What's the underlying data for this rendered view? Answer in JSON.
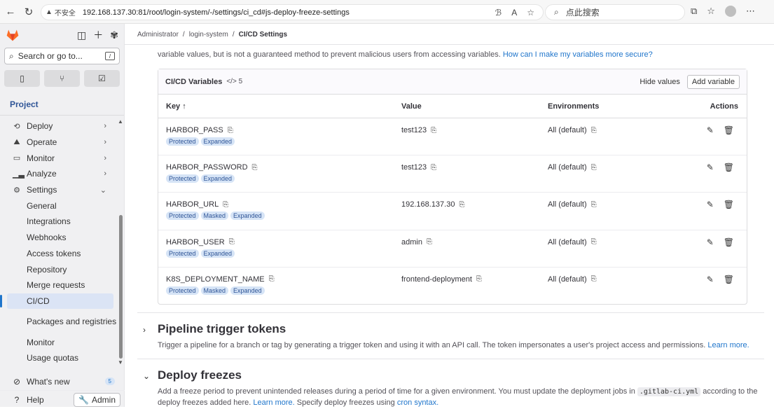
{
  "browser": {
    "security_label": "不安全",
    "url": "192.168.137.30:81/root/login-system/-/settings/ci_cd#js-deploy-freeze-settings",
    "search_placeholder": "点此搜索"
  },
  "sidebar": {
    "search_placeholder": "Search or go to...",
    "section_label": "Project",
    "items": [
      {
        "label": "Deploy",
        "icon": "deploy-icon"
      },
      {
        "label": "Operate",
        "icon": "operate-icon"
      },
      {
        "label": "Monitor",
        "icon": "monitor-icon"
      },
      {
        "label": "Analyze",
        "icon": "analyze-icon"
      },
      {
        "label": "Settings",
        "icon": "settings-icon"
      }
    ],
    "sub_items": [
      "General",
      "Integrations",
      "Webhooks",
      "Access tokens",
      "Repository",
      "Merge requests",
      "CI/CD",
      "Packages and registries",
      "Monitor",
      "Usage quotas"
    ],
    "active_sub": "CI/CD",
    "whats_new": "What's new",
    "whats_new_count": "5",
    "help": "Help",
    "admin": "Admin"
  },
  "breadcrumb": {
    "items": [
      "Administrator",
      "login-system",
      "CI/CD Settings"
    ]
  },
  "intro": {
    "text": "variable values, but is not a guaranteed method to prevent malicious users from accessing variables.",
    "link": "How can I make my variables more secure?"
  },
  "variables": {
    "title": "CI/CD Variables",
    "count": "5",
    "hide_values": "Hide values",
    "add_variable": "Add variable",
    "headers": {
      "key": "Key ↑",
      "value": "Value",
      "environments": "Environments",
      "actions": "Actions"
    },
    "rows": [
      {
        "key": "HARBOR_PASS",
        "value": "test123",
        "env": "All (default)",
        "badges": [
          "Protected",
          "Expanded"
        ]
      },
      {
        "key": "HARBOR_PASSWORD",
        "value": "test123",
        "env": "All (default)",
        "badges": [
          "Protected",
          "Expanded"
        ]
      },
      {
        "key": "HARBOR_URL",
        "value": "192.168.137.30",
        "env": "All (default)",
        "badges": [
          "Protected",
          "Masked",
          "Expanded"
        ]
      },
      {
        "key": "HARBOR_USER",
        "value": "admin",
        "env": "All (default)",
        "badges": [
          "Protected",
          "Expanded"
        ]
      },
      {
        "key": "K8S_DEPLOYMENT_NAME",
        "value": "frontend-deployment",
        "env": "All (default)",
        "badges": [
          "Protected",
          "Masked",
          "Expanded"
        ]
      }
    ]
  },
  "pipeline_trigger": {
    "title": "Pipeline trigger tokens",
    "description": "Trigger a pipeline for a branch or tag by generating a trigger token and using it with an API call. The token impersonates a user's project access and permissions.",
    "link": "Learn more."
  },
  "deploy_freezes": {
    "title": "Deploy freezes",
    "desc_line1_a": "Add a freeze period to prevent unintended releases during a period of time for a given environment. You must update the deployment jobs in",
    "desc_code": ".gitlab-ci.yml",
    "desc_line1_b": "according to the",
    "desc_line2_a": "deploy freezes added here.",
    "link1": "Learn more.",
    "desc_line2_b": "Specify deploy freezes using",
    "link2": "cron syntax."
  }
}
